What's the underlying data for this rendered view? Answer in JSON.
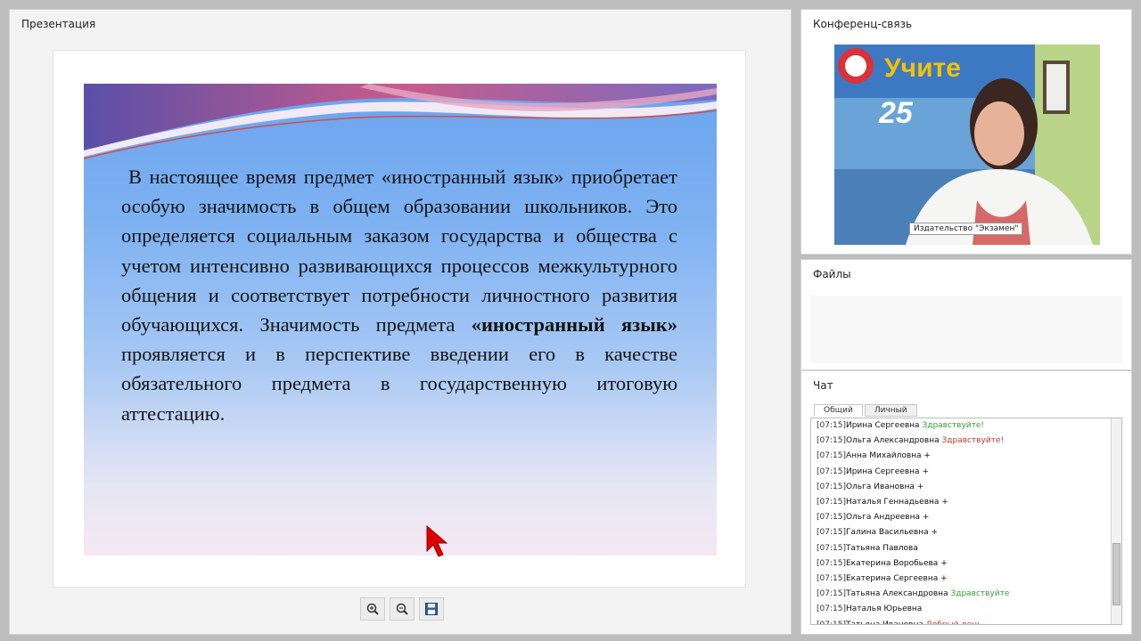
{
  "presentation": {
    "title": "Презентация",
    "slide": {
      "para1": "В настоящее время  предмет «иностранный язык» приобретает особую значимость в общем образовании школьников. Это определяется социальным заказом государства и общества с учетом интенсивно развивающихся процессов межкультурного общения и соответствует потребности личностного развития обучающихся. Значимость предмета ",
      "bold": "«иностранный язык»",
      "para2": " проявляется и в перспективе введении его в качестве обязательного предмета в государственную итоговую аттестацию."
    },
    "toolbar": {
      "zoom_in": "zoom-in-icon",
      "zoom_out": "zoom-out-icon",
      "save": "save-icon"
    }
  },
  "conference": {
    "title": "Конференц-связь",
    "banner_text": "Учите",
    "banner_sub": "25",
    "video_label": "Издательство \"Экзамен\""
  },
  "files": {
    "title": "Файлы"
  },
  "chat": {
    "title": "Чат",
    "tabs": [
      "Общий",
      "Личный"
    ],
    "messages": [
      {
        "ts": "[07:15]",
        "name": "Ирина Сергеевна",
        "text": "Здравствуйте!",
        "color": "#3a9a3a"
      },
      {
        "ts": "[07:15]",
        "name": "Ольга Александровна",
        "text": "Здравствуйте!",
        "color": "#c0392b"
      },
      {
        "ts": "[07:15]",
        "name": "Анна Михайловна",
        "text": "+",
        "color": "#111111"
      },
      {
        "ts": "[07:15]",
        "name": "Ирина Сергеевна",
        "text": "+",
        "color": "#111111"
      },
      {
        "ts": "[07:15]",
        "name": "Ольга Ивановна",
        "text": "+",
        "color": "#111111"
      },
      {
        "ts": "[07:15]",
        "name": "Наталья Геннадьевна",
        "text": "+",
        "color": "#111111"
      },
      {
        "ts": "[07:15]",
        "name": "Ольга Андреевна",
        "text": "+",
        "color": "#111111"
      },
      {
        "ts": "[07:15]",
        "name": "Галина Васильевна",
        "text": "+",
        "color": "#111111"
      },
      {
        "ts": "[07:15]",
        "name": "Татьяна Павлова",
        "text": "",
        "color": "#111111"
      },
      {
        "ts": "[07:15]",
        "name": "Екатерина Воробьева",
        "text": "+",
        "color": "#111111"
      },
      {
        "ts": "[07:15]",
        "name": "Екатерина Сергеевна",
        "text": "+",
        "color": "#111111"
      },
      {
        "ts": "[07:15]",
        "name": "Татьяна Александровна",
        "text": "Здравствуйте",
        "color": "#3a9a3a"
      },
      {
        "ts": "[07:15]",
        "name": "Наталья Юрьевна",
        "text": "",
        "color": "#111111"
      },
      {
        "ts": "[07:15]",
        "name": "Татьяна Ивановна",
        "text": "Добрый день",
        "color": "#c0392b"
      }
    ]
  },
  "colors": {
    "slide_top": "#6aa3ee",
    "slide_bottom": "#f4e9f3",
    "cursor": "#e00000"
  }
}
